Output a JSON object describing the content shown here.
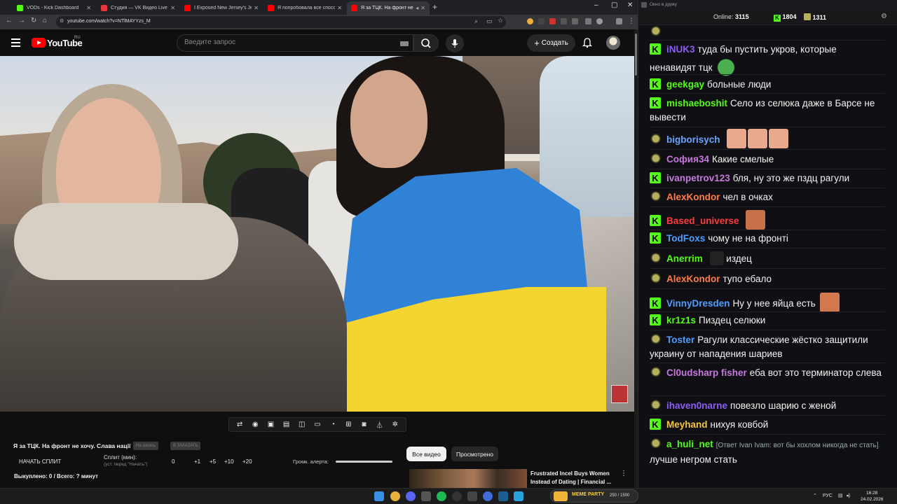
{
  "browser": {
    "tabs": [
      {
        "title": "VODs - Kick Dashboard",
        "favicon_color": "#53fc18"
      },
      {
        "title": "Студия — VK Видео Live",
        "favicon_color": "#e8343b"
      },
      {
        "title": "I Exposed New Jersey's Jewish",
        "favicon_color": "#ff0000"
      },
      {
        "title": "Я попробовала все способы б",
        "favicon_color": "#ff0000"
      },
      {
        "title": "Я за ТЦК. На фронт не хоч",
        "favicon_color": "#ff0000",
        "active": true
      }
    ],
    "url": "youtube.com/watch?v=NTlMAYYzs_M",
    "window_controls": [
      "–",
      "▢",
      "✕"
    ]
  },
  "youtube": {
    "logo_text": "YouTube",
    "region": "RU",
    "search_placeholder": "Введите запрос",
    "create_label": "Создать"
  },
  "player_toolbar": {
    "icons": [
      "loop-icon",
      "broadcast-icon",
      "screenshot-icon",
      "filmstrip-icon",
      "pip-icon",
      "subtitles-icon",
      "speed-icon",
      "add-clip-icon",
      "camera-icon",
      "flask-icon",
      "settings-icon"
    ]
  },
  "panel": {
    "video_title": "Я за ТЦК. На фронт не хочу. Слава нації",
    "ghost_btn_1": "На запись",
    "ghost_btn_2": "В ЗАКАЗАТЬ",
    "split_start": "НАЧАТЬ СПЛИТ",
    "split_label": "Сплит (мин):",
    "split_sub": "(уст. перед \"Начать\")",
    "split_values": [
      "0",
      "+1",
      "+5",
      "+10",
      "+20"
    ],
    "alert_label": "Громк. алерта:",
    "alert_volume": 1.0,
    "bought": "Выкуплено: 0 / Всего: ? минут",
    "chips": [
      "Все видео",
      "Просмотрено"
    ],
    "rec_title": "Frustrated Incel Buys Women Instead of Dating | Financial ..."
  },
  "chat": {
    "window_title": "Окно в дурку",
    "online_label": "Online:",
    "online_count": "3115",
    "kick_count": "1804",
    "pepe_count": "1311",
    "messages": [
      {
        "badge": "pepe",
        "user": "",
        "color": "#ffffff",
        "text": ""
      },
      {
        "badge": "k",
        "user": "iNUK3",
        "color": "#8b5cf6",
        "text": "туда бы пустить укров, которые ненавидят тцк",
        "emotes": [
          "pepe-emote"
        ]
      },
      {
        "badge": "k",
        "user": "geekgay",
        "color": "#53fc18",
        "text": "больные люди"
      },
      {
        "badge": "k",
        "user": "mishaeboshit",
        "color": "#53fc18",
        "text": "Село из селюка даже в Барсе не вывести"
      },
      {
        "badge": "pepe",
        "user": "bigborisych",
        "color": "#6aa3ff",
        "text": "",
        "emotes": [
          "face-emote",
          "face-emote",
          "face-emote"
        ]
      },
      {
        "badge": "pepe",
        "user": "София34",
        "color": "#c678dd",
        "text": "Какие смелые"
      },
      {
        "badge": "k",
        "user": "ivanpetrov123",
        "color": "#c678dd",
        "text": "бля, ну это же пздц рагули"
      },
      {
        "badge": "pepe",
        "user": "AlexKondor",
        "color": "#ff7b47",
        "text": "чел в очках"
      },
      {
        "badge": "k",
        "user": "Based_universe",
        "color": "#ff3b3b",
        "text": "",
        "emotes": [
          "laugh-emote"
        ]
      },
      {
        "badge": "k",
        "user": "TodFoxs",
        "color": "#4f9dff",
        "text": "чому не на фронті"
      },
      {
        "badge": "pepe",
        "user": "Anerrim",
        "color": "#53fc18",
        "text": "издец",
        "emotes": [
          "small-emote"
        ]
      },
      {
        "badge": "pepe",
        "user": "AlexKondor",
        "color": "#ff7b47",
        "text": "тупо ебало"
      },
      {
        "badge": "k",
        "user": "VinnyDresden",
        "color": "#4f9dff",
        "text": "Ну у нее яйца есть",
        "emotes": [
          "face-emote"
        ]
      },
      {
        "badge": "k",
        "user": "kr1z1s",
        "color": "#53fc18",
        "text": "Пиздец селюки"
      },
      {
        "badge": "pepe",
        "user": "Toster",
        "color": "#4f9dff",
        "text": "Рагули классические жёстко защитили украину от нападения шариев"
      },
      {
        "badge": "pepe",
        "user": "Cl0udsharp fisher",
        "color": "#c678dd",
        "text": "еба вот это терминатор слева"
      },
      {
        "badge": "pepe",
        "user": "ihaven0narne",
        "color": "#8b5cf6",
        "text": "повезло шарию с женой"
      },
      {
        "badge": "k",
        "user": "Meyhand",
        "color": "#f5c542",
        "text": "нихуя ковбой"
      },
      {
        "badge": "pepe",
        "user": "a_huli_net",
        "color": "#53fc18",
        "reply": "[Ответ Ivan Ivam: вот бы хохлом никогда не стать]",
        "text": "лучше негром стать"
      }
    ]
  },
  "taskbar": {
    "meme_label": "MEME PARTY",
    "meme_value": "250 / 1500",
    "lang": "РУС",
    "time": "16:28",
    "date": "24.02.2026"
  }
}
